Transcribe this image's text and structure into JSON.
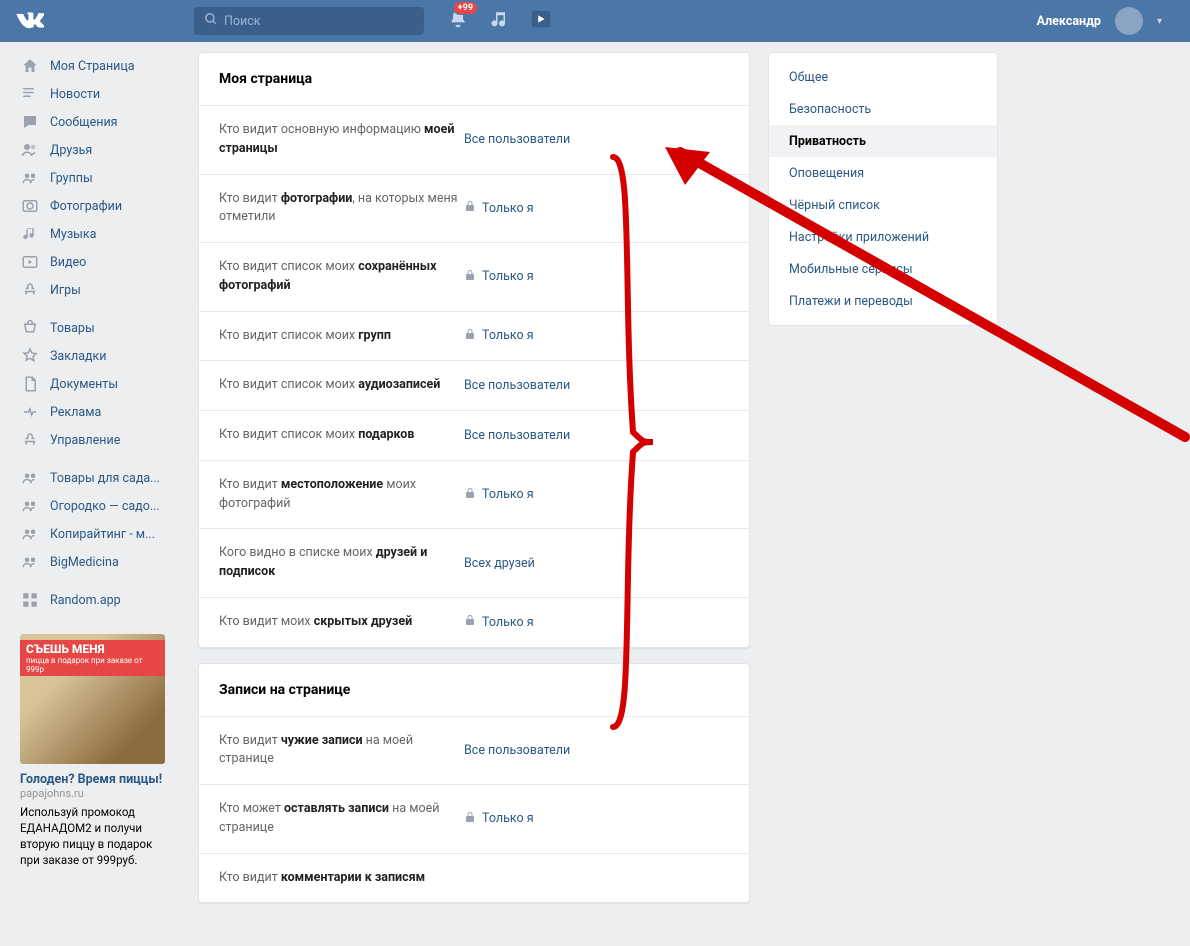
{
  "header": {
    "search_placeholder": "Поиск",
    "badge": "+99",
    "username": "Александр"
  },
  "left_nav": {
    "items": [
      {
        "label": "Моя Страница"
      },
      {
        "label": "Новости"
      },
      {
        "label": "Сообщения"
      },
      {
        "label": "Друзья"
      },
      {
        "label": "Группы"
      },
      {
        "label": "Фотографии"
      },
      {
        "label": "Музыка"
      },
      {
        "label": "Видео"
      },
      {
        "label": "Игры"
      }
    ],
    "items2": [
      {
        "label": "Товары"
      },
      {
        "label": "Закладки"
      },
      {
        "label": "Документы"
      },
      {
        "label": "Реклама"
      },
      {
        "label": "Управление"
      }
    ],
    "items3": [
      {
        "label": "Товары для сада..."
      },
      {
        "label": "Огородко — садо..."
      },
      {
        "label": "Копирайтинг - м..."
      },
      {
        "label": "BigMedicina"
      }
    ],
    "items4": [
      {
        "label": "Random.app"
      }
    ]
  },
  "ad": {
    "banner": "СЪЕШЬ МЕНЯ",
    "banner_sub": "пицца в подарок при заказе от 999р",
    "title": "Голоден? Время пиццы!",
    "domain": "papajohns.ru",
    "text": "Используй промокод ЕДАНАДОМ2 и получи вторую пиццу в подарок при заказе от 999руб."
  },
  "sections": [
    {
      "title": "Моя страница",
      "rows": [
        {
          "pre": "Кто видит основную информацию ",
          "bold": "моей страницы",
          "val": "Все пользователи",
          "lock": false
        },
        {
          "pre": "Кто видит ",
          "bold": "фотографии",
          "post": ", на которых меня отметили",
          "val": "Только я",
          "lock": true
        },
        {
          "pre": "Кто видит список моих ",
          "bold": "сохранённых фотографий",
          "val": "Только я",
          "lock": true
        },
        {
          "pre": "Кто видит список моих ",
          "bold": "групп",
          "val": "Только я",
          "lock": true
        },
        {
          "pre": "Кто видит список моих ",
          "bold": "аудиозаписей",
          "val": "Все пользователи",
          "lock": false
        },
        {
          "pre": "Кто видит список моих ",
          "bold": "подарков",
          "val": "Все пользователи",
          "lock": false
        },
        {
          "pre": "Кто видит ",
          "bold": "местоположение",
          "post": " моих фотографий",
          "val": "Только я",
          "lock": true
        },
        {
          "pre": "Кого видно в списке моих ",
          "bold": "друзей и подписок",
          "val": "Всех друзей",
          "lock": false
        },
        {
          "pre": "Кто видит моих ",
          "bold": "скрытых друзей",
          "val": "Только я",
          "lock": true
        }
      ]
    },
    {
      "title": "Записи на странице",
      "rows": [
        {
          "pre": "Кто видит ",
          "bold": "чужие записи",
          "post": " на моей странице",
          "val": "Все пользователи",
          "lock": false
        },
        {
          "pre": "Кто может ",
          "bold": "оставлять записи",
          "post": " на моей странице",
          "val": "Только я",
          "lock": true
        },
        {
          "pre": "Кто видит ",
          "bold": "комментарии к записям",
          "val": "",
          "lock": false
        }
      ]
    }
  ],
  "right_nav": {
    "items": [
      {
        "label": "Общее",
        "active": false
      },
      {
        "label": "Безопасность",
        "active": false
      },
      {
        "label": "Приватность",
        "active": true
      },
      {
        "label": "Оповещения",
        "active": false
      },
      {
        "label": "Чёрный список",
        "active": false
      },
      {
        "label": "Настройки приложений",
        "active": false
      },
      {
        "label": "Мобильные сервисы",
        "active": false
      },
      {
        "label": "Платежи и переводы",
        "active": false
      }
    ]
  }
}
